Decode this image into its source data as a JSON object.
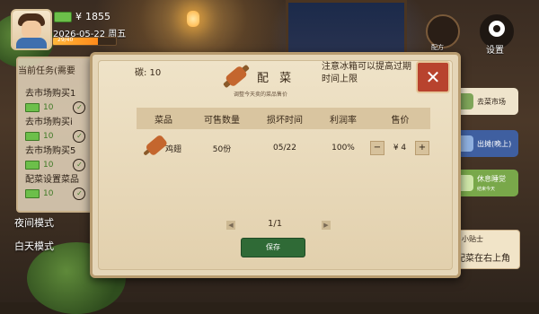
{
  "hud": {
    "money": "1855",
    "date": "2026-05-22 周五",
    "xp_text": "29/40",
    "xp_fraction": 0.72
  },
  "tasks": {
    "title": "当前任务(需要",
    "items": [
      {
        "label": "去市场购买1",
        "reward": "10"
      },
      {
        "label": "去市场购买i",
        "reward": "10"
      },
      {
        "label": "去市场购买5",
        "reward": "10"
      },
      {
        "label": "配菜设置菜品",
        "reward": "10"
      }
    ]
  },
  "modes": {
    "night": "夜间模式",
    "day": "白天模式"
  },
  "right": {
    "top_icons": [
      {
        "name": "dish-icon",
        "label": "配方"
      },
      {
        "name": "gear-icon",
        "label": "设置"
      }
    ],
    "buttons": [
      {
        "label": "去菜市场",
        "sub": ""
      },
      {
        "label": "出摊(晚上)",
        "sub": ""
      },
      {
        "label": "休息睡觉",
        "sub": "结束今天"
      }
    ],
    "tip_title": "小贴士",
    "tip_text": "配菜在右上角"
  },
  "dialog": {
    "stock": "碳: 10",
    "title": "配 菜",
    "subtitle": "调整今天卖的菜品售价",
    "note": "注意冰箱可以提高过期时间上限",
    "close": "✕",
    "columns": [
      "菜品",
      "可售数量",
      "损坏时间",
      "利润率",
      "售价"
    ],
    "rows": [
      {
        "dish": "鸡翅",
        "qty": "50份",
        "expire": "05/22",
        "margin": "100%",
        "price": "¥ 4",
        "minus": "−",
        "plus": "+"
      }
    ],
    "page": "1/1",
    "save": "保存"
  }
}
